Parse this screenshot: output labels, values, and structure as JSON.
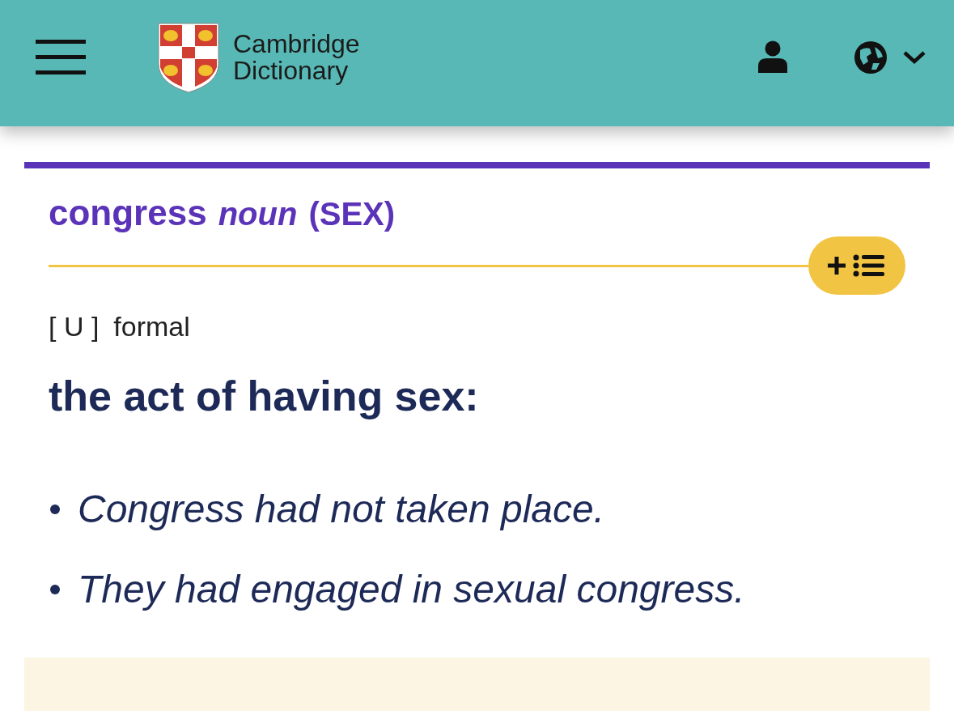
{
  "header": {
    "logo_text": "Cambridge Dictionary"
  },
  "entry": {
    "headword": "congress",
    "part_of_speech": "noun",
    "guide_word": "(SEX)",
    "grammar_code": "[ U ]",
    "register": "formal",
    "definition": "the act of having sex:",
    "examples": [
      "Congress had not taken place.",
      "They had engaged in sexual congress."
    ]
  }
}
